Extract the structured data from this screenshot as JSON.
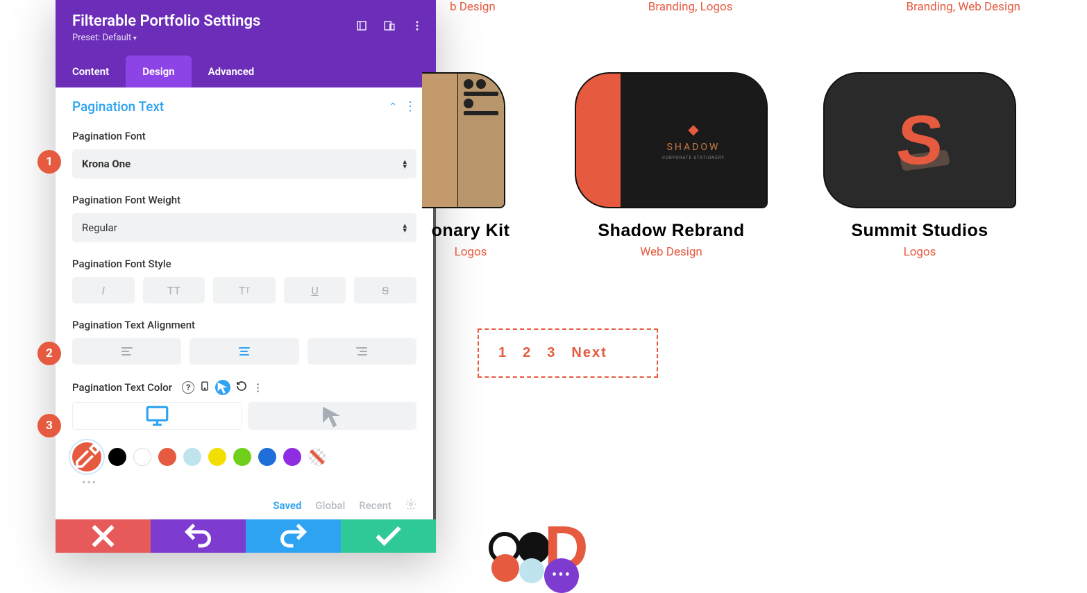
{
  "panel": {
    "title": "Filterable Portfolio Settings",
    "preset": "Preset: Default",
    "tabs": {
      "content": "Content",
      "design": "Design",
      "advanced": "Advanced"
    },
    "section_title": "Pagination Text",
    "fields": {
      "font": {
        "label": "Pagination Font",
        "value": "Krona One"
      },
      "weight": {
        "label": "Pagination Font Weight",
        "value": "Regular"
      },
      "style": {
        "label": "Pagination Font Style"
      },
      "align": {
        "label": "Pagination Text Alignment"
      },
      "color": {
        "label": "Pagination Text Color"
      }
    },
    "palette": {
      "picker": "#e65a3f",
      "swatches": [
        "#000000",
        "#ffffff",
        "#e65a3f",
        "#bfe4ee",
        "#f2de00",
        "#6fcf1b",
        "#1e6fd9",
        "#8e2de2"
      ]
    },
    "saved_tabs": {
      "saved": "Saved",
      "global": "Global",
      "recent": "Recent"
    },
    "badges": {
      "b1": "1",
      "b2": "2",
      "b3": "3"
    }
  },
  "preview": {
    "top_categories": [
      "b Design",
      "Branding, Logos",
      "Branding, Web Design"
    ],
    "cards": {
      "c1": {
        "title_fragment": "onary Kit",
        "cat": "Logos"
      },
      "c2": {
        "title": "Shadow Rebrand",
        "cat": "Web Design",
        "brand": "SHADOW"
      },
      "c3": {
        "title": "Summit Studios",
        "cat": "Logos"
      }
    },
    "pagination": {
      "p1": "1",
      "p2": "2",
      "p3": "3",
      "next": "Next"
    }
  }
}
